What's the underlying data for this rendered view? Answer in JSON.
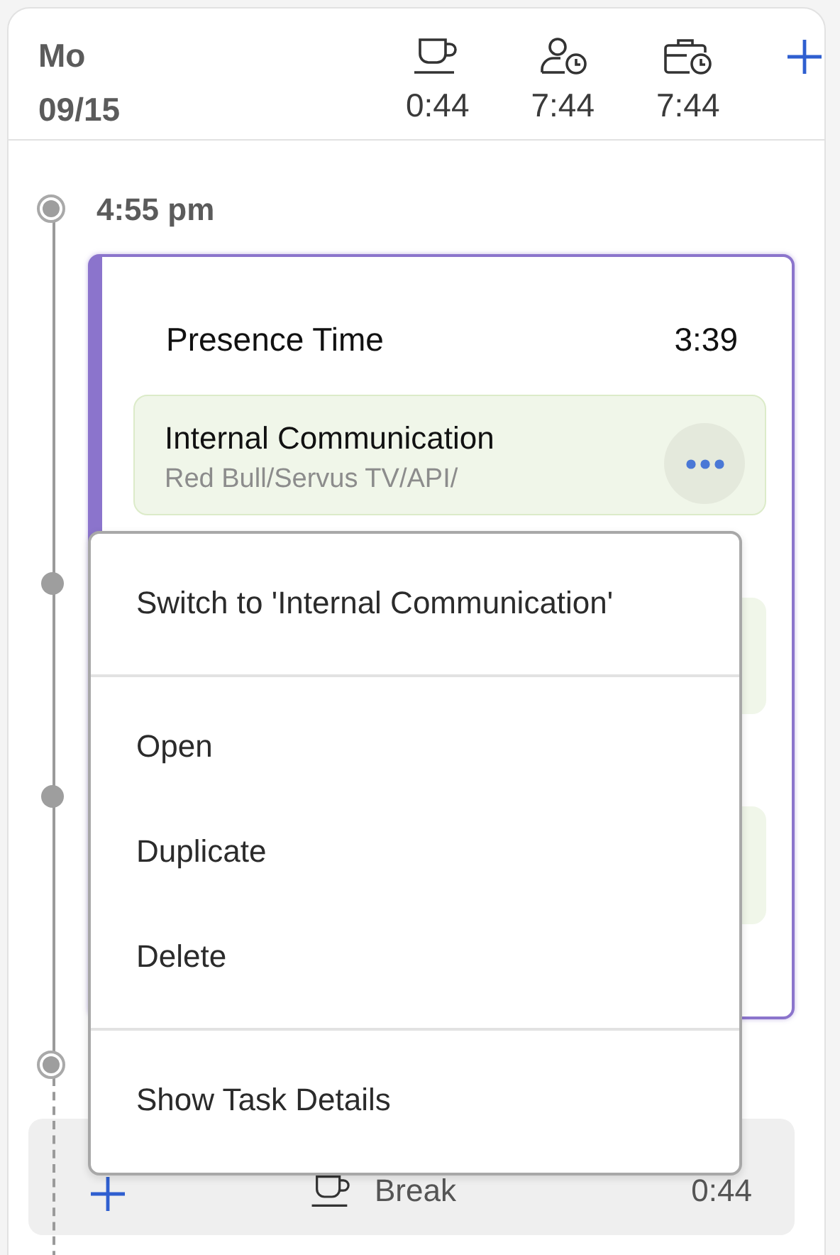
{
  "day": {
    "weekday": "Mo",
    "date": "09/15"
  },
  "totals": [
    {
      "kind": "break",
      "value": "0:44"
    },
    {
      "kind": "presence",
      "value": "7:44"
    },
    {
      "kind": "work",
      "value": "7:44"
    }
  ],
  "timeline": {
    "start_time": "4:55 pm",
    "block": {
      "title": "Presence Time",
      "duration": "3:39",
      "entries": [
        {
          "kind": "task",
          "title": "Internal Communication",
          "path": "Red Bull/Servus TV/API/"
        },
        {
          "kind": "covered"
        },
        {
          "kind": "covered"
        }
      ]
    },
    "break_row": {
      "label": "Break",
      "duration": "0:44"
    }
  },
  "context_menu": {
    "sections": [
      [
        "Switch to 'Internal Communication'"
      ],
      [
        "Open",
        "Duplicate",
        "Delete"
      ],
      [
        "Show Task Details"
      ]
    ]
  }
}
